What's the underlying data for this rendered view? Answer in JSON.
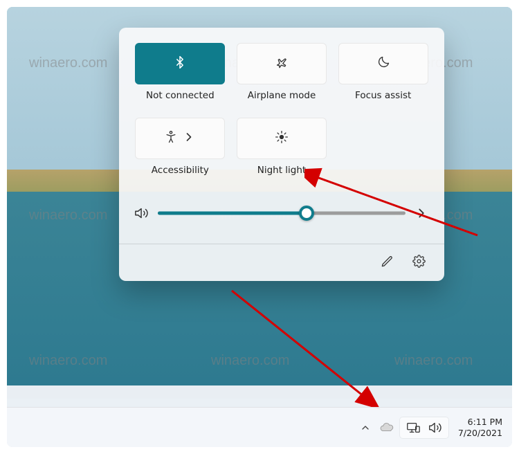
{
  "tiles": [
    {
      "label": "Not connected",
      "icon": "bluetooth",
      "active": true
    },
    {
      "label": "Airplane mode",
      "icon": "airplane",
      "active": false
    },
    {
      "label": "Focus assist",
      "icon": "moon",
      "active": false
    },
    {
      "label": "Accessibility",
      "icon": "accessibility",
      "active": false,
      "hasChevron": true
    },
    {
      "label": "Night light",
      "icon": "brightness",
      "active": false
    }
  ],
  "volume": {
    "percent": 60
  },
  "taskbar": {
    "time": "6:11 PM",
    "date": "7/20/2021"
  },
  "watermark": "winaero.com"
}
